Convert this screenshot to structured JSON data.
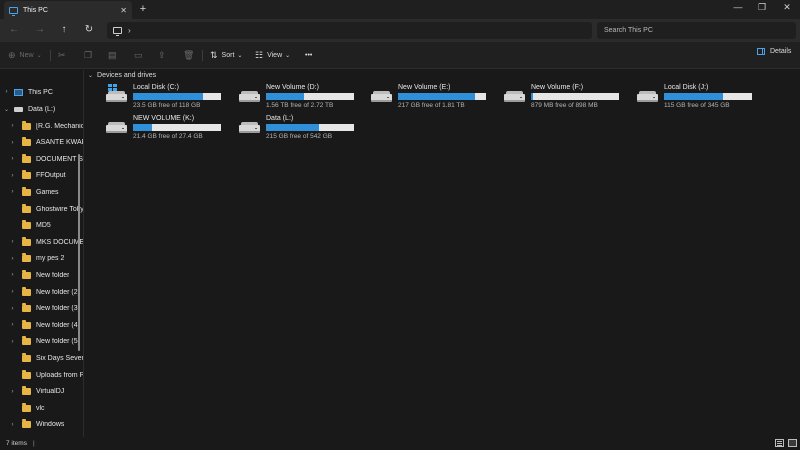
{
  "window": {
    "tab_title": "This PC",
    "tab_icon": "computer-icon",
    "new_tab_label": "+",
    "controls": [
      "—",
      "❐",
      "✕"
    ]
  },
  "address": {
    "back": "←",
    "forward": "→",
    "up": "↑",
    "refresh": "↻",
    "chevron": "›",
    "search_placeholder": "Search This PC"
  },
  "toolbar": {
    "new_label": "New",
    "sort_label": "Sort",
    "view_label": "View",
    "more_label": "•••",
    "details_label": "Details"
  },
  "sidebar": {
    "this_pc": "This PC",
    "data_drive": "Data (L:)",
    "folders": [
      {
        "label": "[R.G. Mechanics]",
        "expandable": true
      },
      {
        "label": "ASANTE KWABENA",
        "expandable": true
      },
      {
        "label": "DOCUMENT SAVE",
        "expandable": true
      },
      {
        "label": "FFOutput",
        "expandable": true
      },
      {
        "label": "Games",
        "expandable": true
      },
      {
        "label": "Ghostwire Tokyo",
        "expandable": false
      },
      {
        "label": "MD5",
        "expandable": false
      },
      {
        "label": "MKS DOCUMENTS",
        "expandable": true
      },
      {
        "label": "my pes 2",
        "expandable": true
      },
      {
        "label": "New folder",
        "expandable": true
      },
      {
        "label": "New folder (2)",
        "expandable": true
      },
      {
        "label": "New folder (3)",
        "expandable": true
      },
      {
        "label": "New folder (4)",
        "expandable": true
      },
      {
        "label": "New folder (5)",
        "expandable": true
      },
      {
        "label": "Six Days Seven Nights",
        "expandable": false
      },
      {
        "label": "Uploads from Phone",
        "expandable": false
      },
      {
        "label": "VirtualDJ",
        "expandable": true
      },
      {
        "label": "vlc",
        "expandable": false
      },
      {
        "label": "Windows",
        "expandable": true
      }
    ]
  },
  "main": {
    "group_title": "Devices and drives",
    "drives": [
      {
        "name": "Local Disk (C:)",
        "free_text": "23.5 GB free of 118 GB",
        "used_fraction": 0.8,
        "system": true
      },
      {
        "name": "New Volume (D:)",
        "free_text": "1.56 TB free of 2.72 TB",
        "used_fraction": 0.43,
        "system": false
      },
      {
        "name": "New Volume (E:)",
        "free_text": "217 GB free of 1.81 TB",
        "used_fraction": 0.88,
        "system": false
      },
      {
        "name": "New Volume (F:)",
        "free_text": "879 MB free of 898 MB",
        "used_fraction": 0.02,
        "system": false
      },
      {
        "name": "Local Disk (J:)",
        "free_text": "115 GB free of 345 GB",
        "used_fraction": 0.67,
        "system": false
      },
      {
        "name": "NEW VOLUME (K:)",
        "free_text": "21.4 GB free of 27.4 GB",
        "used_fraction": 0.22,
        "system": false
      },
      {
        "name": "Data (L:)",
        "free_text": "215 GB free of 542 GB",
        "used_fraction": 0.6,
        "system": false
      }
    ]
  },
  "status": {
    "item_count": "7 items",
    "divider": "|"
  },
  "colors": {
    "accent": "#2f8fd8",
    "folder": "#e6b544",
    "background": "#191919"
  }
}
